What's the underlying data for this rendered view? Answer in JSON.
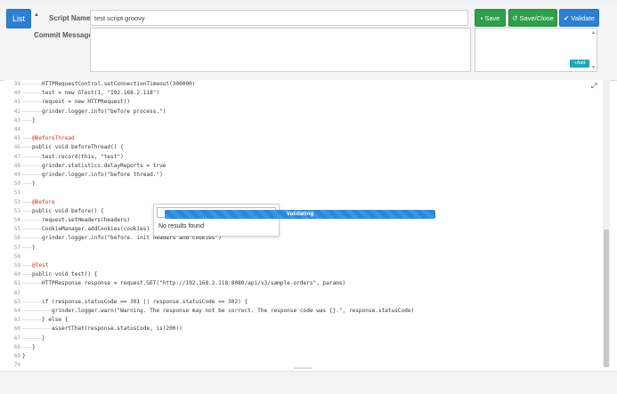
{
  "header": {
    "list_label": "List",
    "script_name_label": "Script Name",
    "script_name_value": "test script groovy",
    "commit_label": "Commit Message",
    "commit_value": "",
    "save_label": "Save",
    "save_close_label": "Save/Close",
    "validate_label": "Validate",
    "add_label": "Add"
  },
  "popup": {
    "no_results": "No results found",
    "validating": "Validating"
  },
  "editor": {
    "lines": [
      {
        "n": "39",
        "t": "——————HTTPRequestControl.setConnectionTimeout(300000)"
      },
      {
        "n": "40",
        "t": "——————test = new GTest(1, \"192.168.2.118\")"
      },
      {
        "n": "41",
        "t": "——————request = new HTTPRequest()"
      },
      {
        "n": "42",
        "t": "——————grinder.logger.info(\"before process.\")"
      },
      {
        "n": "43",
        "t": "———}"
      },
      {
        "n": "44",
        "t": ""
      },
      {
        "n": "45",
        "t": "———@BeforeThread"
      },
      {
        "n": "46",
        "t": "———public void beforeThread() {"
      },
      {
        "n": "47",
        "t": "——————test.record(this, \"test\")"
      },
      {
        "n": "48",
        "t": "——————grinder.statistics.delayReports = true"
      },
      {
        "n": "49",
        "t": "——————grinder.logger.info(\"before thread.\")"
      },
      {
        "n": "50",
        "t": "———}"
      },
      {
        "n": "51",
        "t": ""
      },
      {
        "n": "52",
        "t": "———@Before"
      },
      {
        "n": "53",
        "t": "———public void before() {"
      },
      {
        "n": "54",
        "t": "——————request.setHeaders(headers)"
      },
      {
        "n": "55",
        "t": "——————CookieManager.addCookies(cookies)"
      },
      {
        "n": "56",
        "t": "——————grinder.logger.info(\"before. init headers and cookies\")"
      },
      {
        "n": "57",
        "t": "———}"
      },
      {
        "n": "58",
        "t": ""
      },
      {
        "n": "59",
        "t": "———@Test"
      },
      {
        "n": "60",
        "t": "———public void test() {"
      },
      {
        "n": "61",
        "t": "——————HTTPResponse response = request.GET(\"http://192.168.2.118:8080/api/v3/sample-orders\", params)"
      },
      {
        "n": "62",
        "t": ""
      },
      {
        "n": "63",
        "t": "——————if (response.statusCode == 301 || response.statusCode == 302) {"
      },
      {
        "n": "64",
        "t": "—————————grinder.logger.warn(\"Warning. The response may not be correct. The response code was {}.\", response.statusCode)"
      },
      {
        "n": "65",
        "t": "——————} else {"
      },
      {
        "n": "66",
        "t": "—————————assertThat(response.statusCode, is(200))"
      },
      {
        "n": "67",
        "t": "——————}"
      },
      {
        "n": "68",
        "t": "———}"
      },
      {
        "n": "69",
        "t": "}"
      },
      {
        "n": "70",
        "t": ""
      }
    ]
  },
  "colors": {
    "primary": "#2d7fd0",
    "success": "#2ea049",
    "info": "#20a6b8"
  },
  "icons": {
    "save": "floppy-icon",
    "save_close": "undo-icon",
    "validate": "check-icon",
    "add": "plus-icon",
    "expand": "expand-icon",
    "caret": "caret-up-icon"
  }
}
